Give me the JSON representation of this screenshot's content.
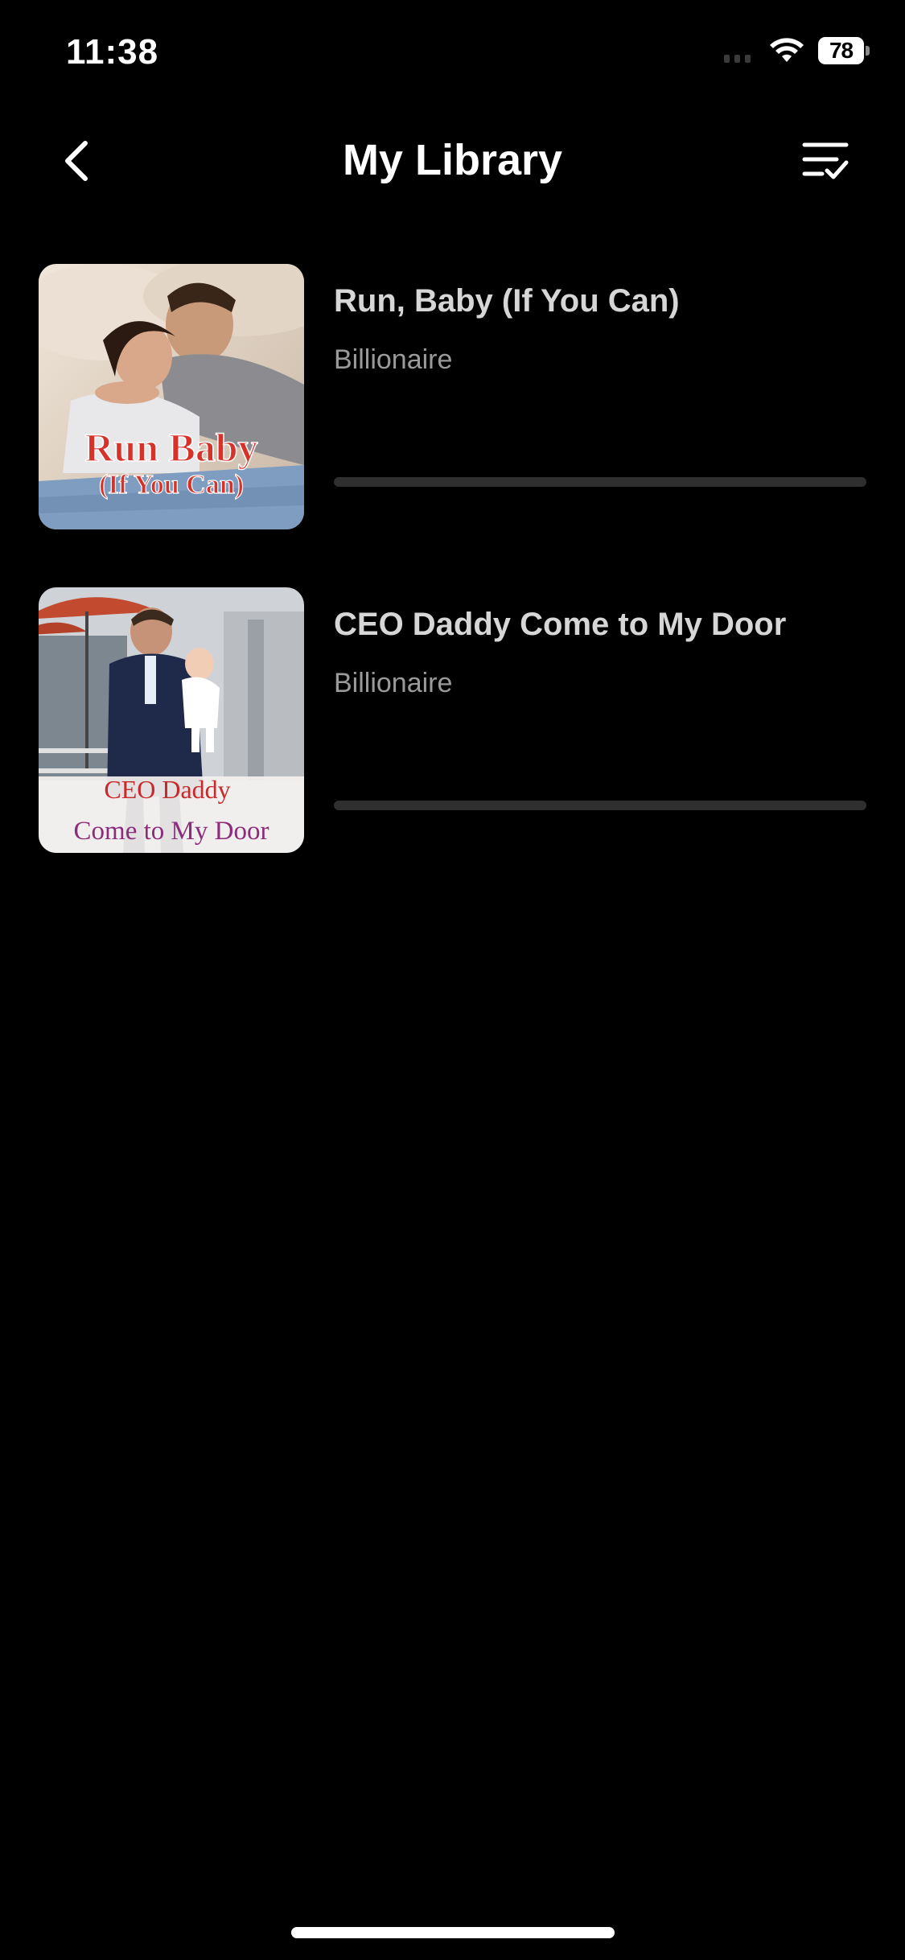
{
  "status_bar": {
    "time": "11:38",
    "battery_level": "78",
    "icons": [
      "signal-icon",
      "wifi-icon",
      "battery-icon"
    ]
  },
  "header": {
    "title": "My Library",
    "back_icon": "chevron-left-icon",
    "action_icon": "list-check-icon"
  },
  "books": [
    {
      "title": "Run, Baby (If You Can)",
      "genre": "Billionaire",
      "cover_text": [
        "Run Baby",
        "(If You Can)"
      ],
      "progress": 0
    },
    {
      "title": "CEO Daddy Come to My Door",
      "genre": "Billionaire",
      "cover_text": [
        "CEO Daddy",
        "Come to My Door"
      ],
      "progress": 0
    }
  ],
  "colors": {
    "background": "#000000",
    "title_text": "#d6d6d6",
    "genre_text": "#9a9a9a",
    "progress_track": "#2f2f2f"
  }
}
